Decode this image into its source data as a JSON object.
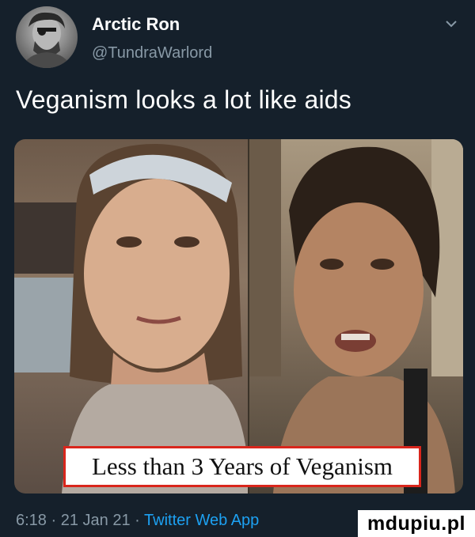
{
  "tweet": {
    "display_name": "Arctic Ron",
    "handle": "@TundraWarlord",
    "text": "Veganism looks a lot like aids",
    "time": "6:18",
    "date": "21 Jan 21",
    "source": "Twitter Web App",
    "separator": "·"
  },
  "media": {
    "caption": "Less than 3 Years of Veganism"
  },
  "watermark": "mdupiu.pl",
  "icons": {
    "menu": "chevron-down-icon"
  },
  "colors": {
    "background": "#15202b",
    "secondary_text": "#8899a6",
    "link": "#1da1f2",
    "caption_border": "#d9261c"
  }
}
